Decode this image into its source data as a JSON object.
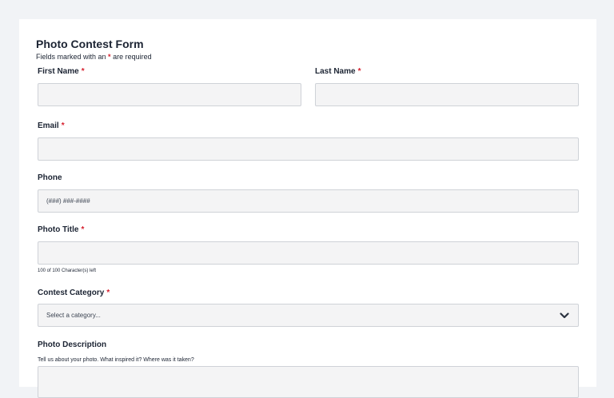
{
  "form": {
    "title": "Photo Contest Form",
    "required_note_prefix": "Fields marked with an ",
    "required_marker": "*",
    "required_note_suffix": " are required",
    "required_color": "#d6202e"
  },
  "fields": {
    "first_name": {
      "label": "First Name",
      "value": ""
    },
    "last_name": {
      "label": "Last Name",
      "value": ""
    },
    "email": {
      "label": "Email",
      "value": ""
    },
    "phone": {
      "label": "Phone",
      "placeholder": "(###) ###-####",
      "value": ""
    },
    "photo_title": {
      "label": "Photo Title",
      "value": "",
      "char_count": "100 of 100 Character(s) left"
    },
    "contest_category": {
      "label": "Contest Category",
      "selected": "Select a category...",
      "icon": "chevron-down-icon"
    },
    "photo_description": {
      "label": "Photo Description",
      "hint": "Tell us about your photo. What inspired it? Where was it taken?",
      "value": ""
    }
  }
}
